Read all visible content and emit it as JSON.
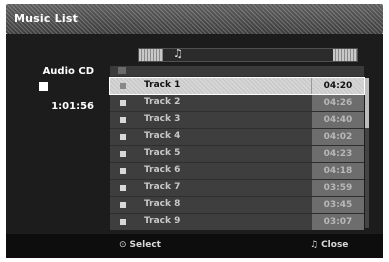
{
  "window": {
    "title": "Music List"
  },
  "info": {
    "source": "Audio CD",
    "total_time": "1:01:56"
  },
  "folder_bar": {
    "icon": "music-note-icon",
    "glyph": "♫"
  },
  "tracks": [
    {
      "name": "Track 1",
      "time": "04:20"
    },
    {
      "name": "Track 2",
      "time": "04:26"
    },
    {
      "name": "Track 3",
      "time": "04:40"
    },
    {
      "name": "Track 4",
      "time": "04:02"
    },
    {
      "name": "Track 5",
      "time": "04:23"
    },
    {
      "name": "Track 6",
      "time": "04:18"
    },
    {
      "name": "Track 7",
      "time": "03:59"
    },
    {
      "name": "Track 8",
      "time": "03:45"
    },
    {
      "name": "Track 9",
      "time": "03:07"
    }
  ],
  "selected_track": "Track 1",
  "footer": {
    "select_glyph": "⊙",
    "select_label": "Select",
    "close_glyph": "♫",
    "close_label": "Close"
  }
}
